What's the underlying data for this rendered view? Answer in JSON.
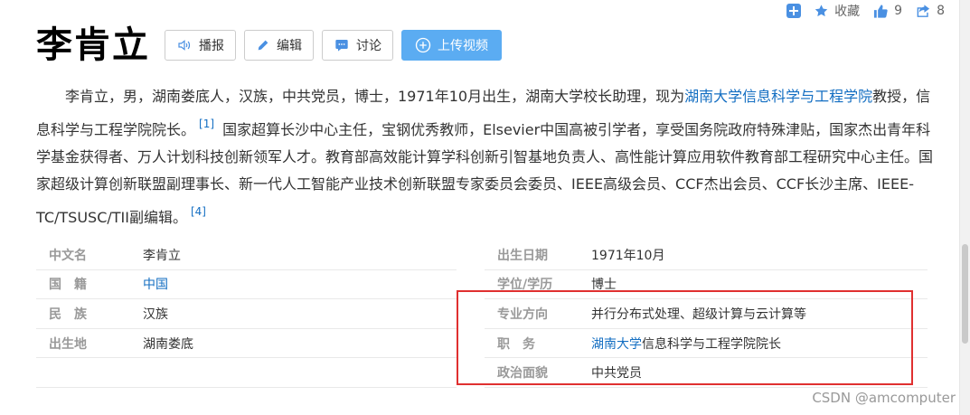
{
  "topbar": {
    "favorite_label": "收藏",
    "like_count": "9",
    "share_count": "8"
  },
  "header": {
    "title": "李肯立",
    "buttons": {
      "broadcast": "播报",
      "edit": "编辑",
      "discuss": "讨论",
      "upload": "上传视频"
    }
  },
  "intro": {
    "p1": "李肯立，男，湖南娄底人，汉族，中共党员，博士，1971年10月出生，湖南大学校长助理，现为",
    "link1": "湖南大学信息科学与工程学院",
    "p2": "教授，信息科学与工程学院院长。",
    "ref1": "[1]",
    "p3": " 国家超算长沙中心主任，宝钢优秀教师，Elsevier中国高被引学者，享受国务院政府特殊津贴，国家杰出青年科学基金获得者、万人计划科技创新领军人才。教育部高效能计算学科创新引智基地负责人、高性能计算应用软件教育部工程研究中心主任。国家超级计算创新联盟副理事长、新一代人工智能产业技术创新联盟专家委员会委员、IEEE高级会员、CCF杰出会员、CCF长沙主席、IEEE-TC/TSUSC/TII副编辑。",
    "ref2": "[4]"
  },
  "basic_info": {
    "left": [
      {
        "key": "中文名",
        "value": "李肯立"
      },
      {
        "key": "国　籍",
        "value": "中国"
      },
      {
        "key": "民　族",
        "value": "汉族"
      },
      {
        "key": "出生地",
        "value": "湖南娄底"
      }
    ],
    "right": [
      {
        "key": "出生日期",
        "value": "1971年10月"
      },
      {
        "key": "学位/学历",
        "value": "博士"
      },
      {
        "key": "专业方向",
        "value": "并行分布式处理、超级计算与云计算等"
      },
      {
        "key": "职　务",
        "link": "湖南大学",
        "value": "信息科学与工程学院院长"
      },
      {
        "key": "政治面貌",
        "value": "中共党员"
      }
    ]
  },
  "watermark": "CSDN @amcomputer",
  "colors": {
    "link": "#136ec2",
    "primary_button": "#5bacf2",
    "highlight_border": "#e03030"
  }
}
